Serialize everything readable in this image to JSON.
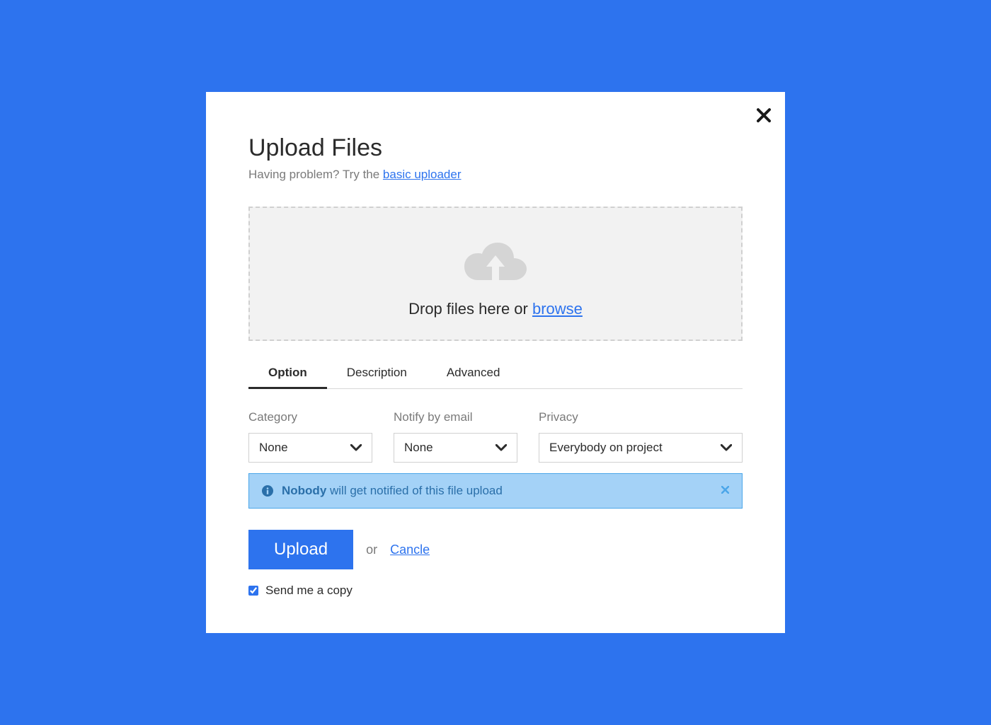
{
  "modal": {
    "title": "Upload Files",
    "subtitle_prefix": "Having problem? Try the ",
    "subtitle_link": "basic uploader",
    "dropzone": {
      "text_prefix": "Drop files here or ",
      "browse_link": "browse"
    },
    "tabs": [
      {
        "label": "Option",
        "active": true
      },
      {
        "label": "Description",
        "active": false
      },
      {
        "label": "Advanced",
        "active": false
      }
    ],
    "form": {
      "category": {
        "label": "Category",
        "value": "None"
      },
      "notify": {
        "label": "Notify by email",
        "value": "None"
      },
      "privacy": {
        "label": "Privacy",
        "value": "Everybody on project"
      }
    },
    "alert": {
      "bold": "Nobody",
      "rest": " will get notified of this file upload"
    },
    "actions": {
      "upload": "Upload",
      "or": "or",
      "cancel": "Cancle"
    },
    "checkbox": {
      "label": "Send me a copy",
      "checked": true
    }
  }
}
